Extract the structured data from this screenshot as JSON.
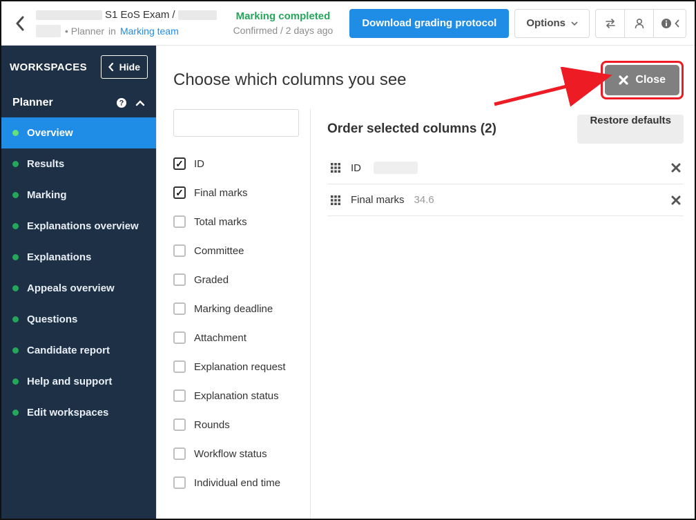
{
  "header": {
    "exam_title": "S1 EoS Exam",
    "slash": "/",
    "planner_prefix": "• Planner",
    "in_word": "in",
    "team_link": "Marking team",
    "status_main": "Marking completed",
    "status_sub": "Confirmed  /  2 days ago",
    "download_btn": "Download grading protocol",
    "options_btn": "Options"
  },
  "sidebar": {
    "ws_title": "WORKSPACES",
    "hide_btn": "Hide",
    "planner_label": "Planner",
    "items": [
      {
        "label": "Overview",
        "active": true
      },
      {
        "label": "Results"
      },
      {
        "label": "Marking"
      },
      {
        "label": "Explanations overview"
      },
      {
        "label": "Explanations"
      },
      {
        "label": "Appeals overview"
      },
      {
        "label": "Questions"
      },
      {
        "label": "Candidate report"
      },
      {
        "label": "Help and support"
      },
      {
        "label": "Edit workspaces"
      }
    ]
  },
  "main": {
    "title": "Choose which columns you see",
    "close_btn": "Close",
    "order_title": "Order selected columns (2)",
    "restore_btn": "Restore defaults",
    "checks": [
      {
        "label": "ID",
        "checked": true
      },
      {
        "label": "Final marks",
        "checked": true
      },
      {
        "label": "Total marks"
      },
      {
        "label": "Committee"
      },
      {
        "label": "Graded"
      },
      {
        "label": "Marking deadline"
      },
      {
        "label": "Attachment"
      },
      {
        "label": "Explanation request"
      },
      {
        "label": "Explanation status"
      },
      {
        "label": "Rounds"
      },
      {
        "label": "Workflow status"
      },
      {
        "label": "Individual end time"
      }
    ],
    "ordered": [
      {
        "label": "ID",
        "value": ""
      },
      {
        "label": "Final marks",
        "value": "34.6"
      }
    ]
  }
}
